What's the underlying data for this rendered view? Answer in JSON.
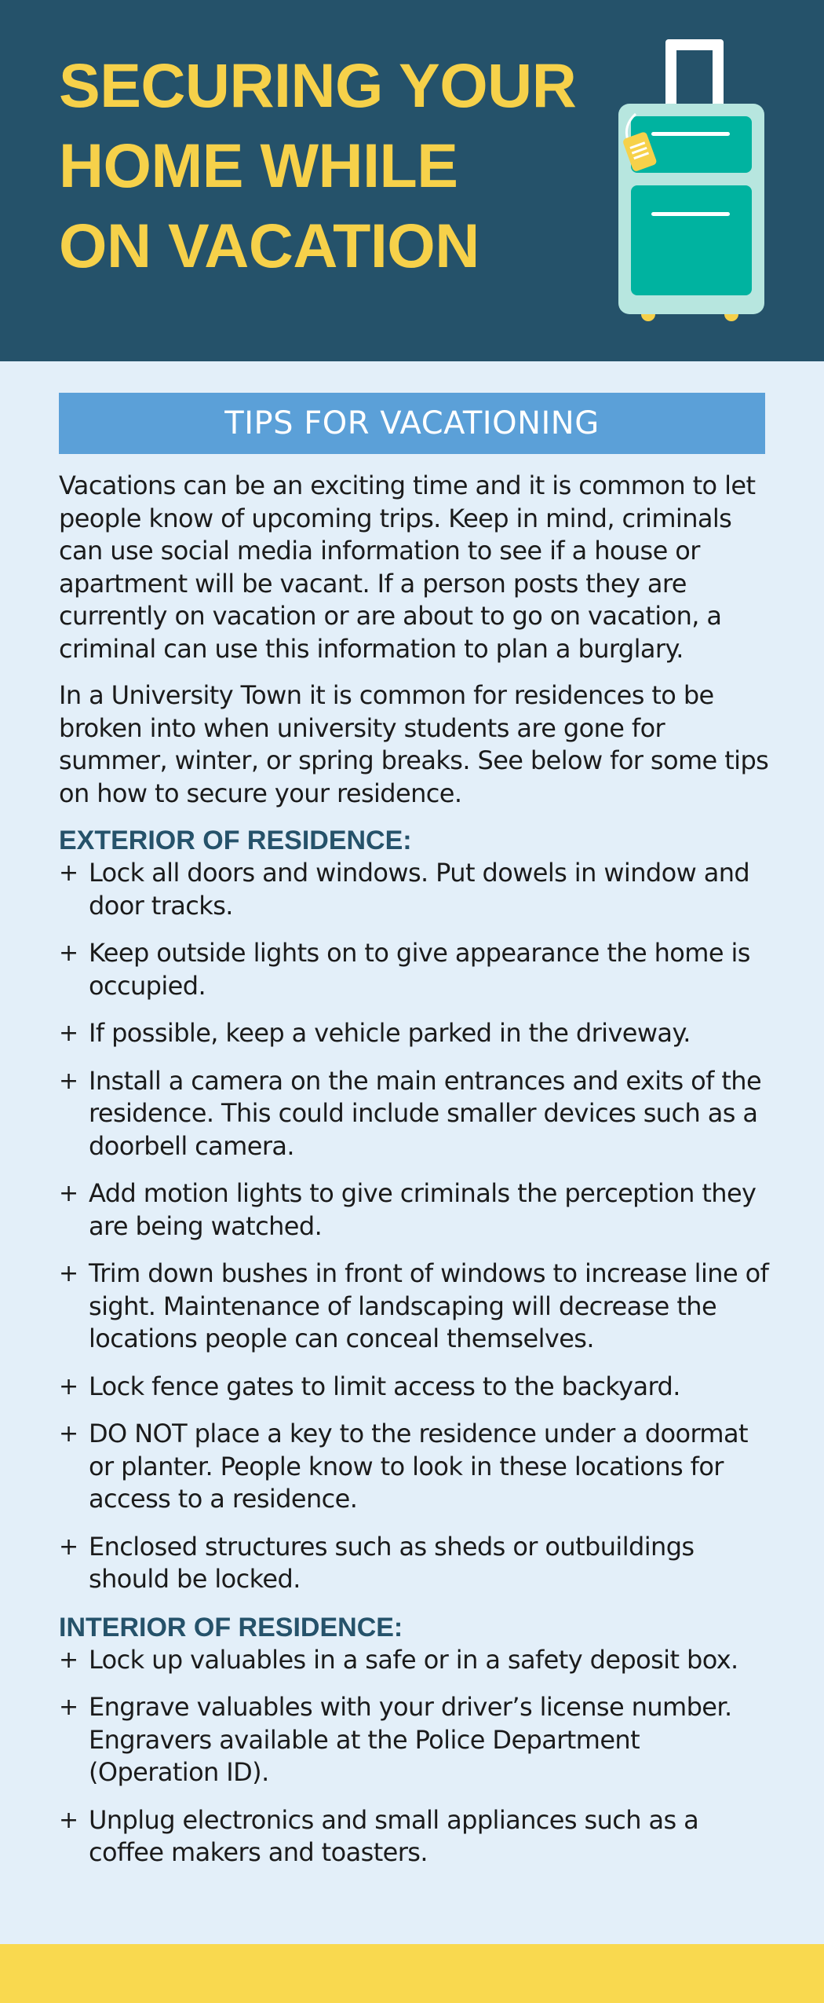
{
  "header": {
    "title_lines": [
      "SECURING YOUR",
      "HOME WHILE",
      "ON VACATION"
    ]
  },
  "colors": {
    "header_bg": "#25526a",
    "title": "#f6d14a",
    "banner": "#5ba0d8",
    "page_bg": "#e3eff9",
    "footer": "#f9d94f",
    "suitcase": "#00b3a0"
  },
  "illustration": "suitcase-icon",
  "banner": {
    "label": "TIPS FOR VACATIONING"
  },
  "intro": [
    "Vacations can be an exciting time and it is common to let people know of upcoming trips. Keep in mind, criminals can use social media information to see if a house or apartment will be vacant. If a person posts they are currently on vacation or are about to go on vacation, a criminal can use this information to plan a burglary.",
    "In a University Town it is common for residences to be broken into when university students are gone for summer, winter, or spring breaks. See below for some tips on how to secure your residence."
  ],
  "bullet_symbol": "+",
  "exterior": {
    "heading": "EXTERIOR OF RESIDENCE:",
    "items": [
      "Lock all doors and windows. Put dowels in window and door tracks.",
      "Keep outside lights on to give appearance the home is occupied.",
      "If possible, keep a vehicle parked in the driveway.",
      "Install a camera on the main entrances and exits of the residence. This could include smaller devices such as a doorbell camera.",
      "Add motion lights to give criminals the perception they are being watched.",
      "Trim down bushes in front of windows to increase line of sight. Maintenance of landscaping will decrease the locations people can conceal themselves.",
      "Lock fence gates to limit access to the backyard.",
      "DO NOT place a key to the residence under a doormat or planter. People know to look in these locations for access to a residence.",
      "Enclosed structures such as sheds or outbuildings should be locked."
    ]
  },
  "interior": {
    "heading": "INTERIOR OF RESIDENCE:",
    "items": [
      "Lock up valuables in a safe or in a safety deposit box.",
      "Engrave valuables with your driver’s license number. Engravers available at the Police Department (Operation ID).",
      "Unplug electronics and small appliances such as a coffee makers and toasters."
    ]
  }
}
